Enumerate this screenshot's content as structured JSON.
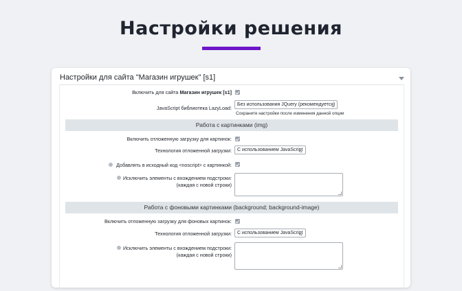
{
  "page": {
    "title": "Настройки решения"
  },
  "panel": {
    "header": "Настройки для сайта \"Магазин игрушек\" [s1]"
  },
  "enable_site": {
    "label_prefix": "Включить для сайта",
    "label_bold": "Магазин игрушек [s1]"
  },
  "lazyload_lib": {
    "label": "JavaScript библиотека LazyLoad:",
    "selected": "Без использования JQuery (рекомендуется)",
    "hint": "Сохраните настройки после изменения данной опции"
  },
  "images_section": {
    "title": "Работа с картинками (img)",
    "enable_label": "Включить отложенную загрузку для картинок:",
    "tech_label": "Технология отложенной загрузки:",
    "tech_selected": "С использованием JavaScript",
    "noscript_label": "Добавлять в исходный код <noscript> с картинкой:",
    "exclude_label_1": "Исключить элементы с вхождением подстроки:",
    "exclude_label_2": "(каждая с новой строки)"
  },
  "bg_section": {
    "title": "Работа с фоновыми картинками (background; background-image)",
    "enable_label": "Включить отложенную загрузку для фоновых картинок:",
    "tech_label": "Технология отложенной загрузки:",
    "tech_selected": "С использованием JavaScript",
    "exclude_label_1": "Исключить элементы с вхождением подстроки:",
    "exclude_label_2": "(каждая с новой строки)"
  },
  "icons": {
    "collapse": "chevron-down-icon",
    "help": "help-icon",
    "checkbox": "checkbox-checked"
  },
  "colors": {
    "accent": "#6d16c9",
    "section_bg": "#dfe4e8"
  }
}
